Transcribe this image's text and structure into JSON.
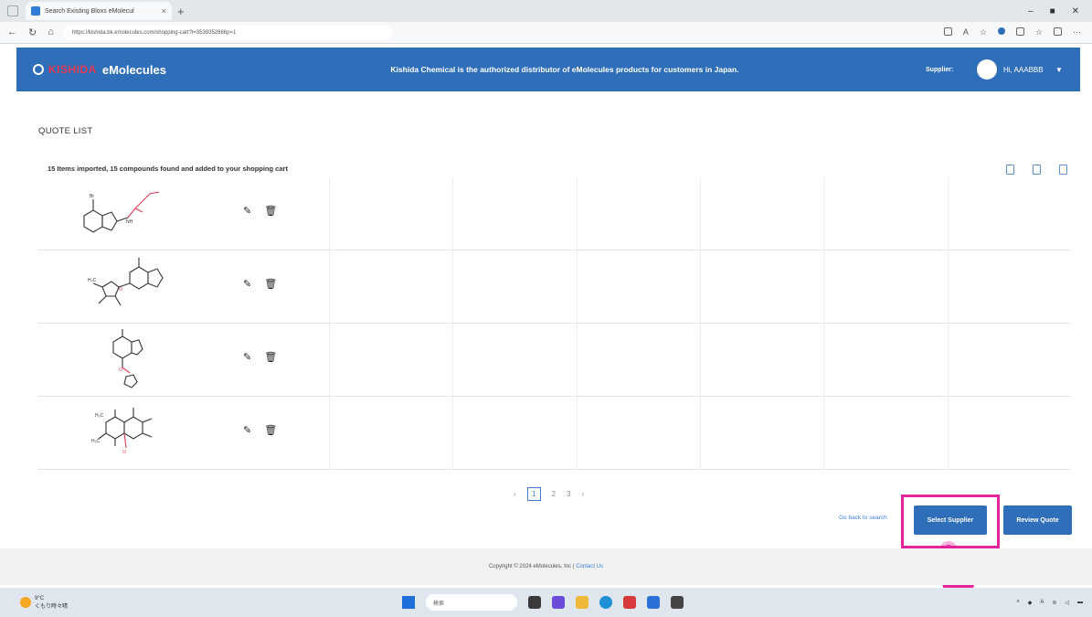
{
  "browser": {
    "tab_title": "Search Existing Bloxs eMolecul",
    "tab_close": "×",
    "new_tab": "+",
    "url": "https://kishida.bk.emolecules.com/shopping-cart?l=3539352886p=1",
    "window_controls": [
      "–",
      "■",
      "✕"
    ]
  },
  "header": {
    "brand_primary": "KISHIDA",
    "brand_secondary": "eMolecules",
    "tagline": "Kishida Chemical is the authorized distributor of eMolecules products for customers in Japan.",
    "supplier_label": "Supplier:",
    "greeting": "Hi, AAABBB",
    "caret": "▼"
  },
  "main": {
    "title": "QUOTE LIST",
    "import_message": "15 Items imported, 15 compounds found and added to your shopping cart",
    "rows": [
      {
        "edit_icon": "pencil-icon",
        "delete_icon": "trash-icon"
      },
      {
        "edit_icon": "pencil-icon",
        "delete_icon": "trash-icon"
      },
      {
        "edit_icon": "pencil-icon",
        "delete_icon": "trash-icon"
      },
      {
        "edit_icon": "pencil-icon",
        "delete_icon": "trash-icon"
      }
    ],
    "pagination": {
      "prev": "‹",
      "pages": [
        "1",
        "2",
        "3"
      ],
      "next": "›",
      "current": "1"
    },
    "go_back_link": "Go back to search",
    "select_supplier_button": "Select Supplier",
    "review_quote_button": "Review Quote"
  },
  "footer": {
    "copyright": "Copyright © 2024 eMolecules, Inc | ",
    "contact_link": "Contact Us"
  },
  "taskbar": {
    "weather_temp": "9°C",
    "weather_desc": "くもり時々晴",
    "search_placeholder": "検索"
  },
  "colors": {
    "primary": "#2f6eb8",
    "highlight": "#e4249a",
    "brand_red": "#e23b55"
  }
}
